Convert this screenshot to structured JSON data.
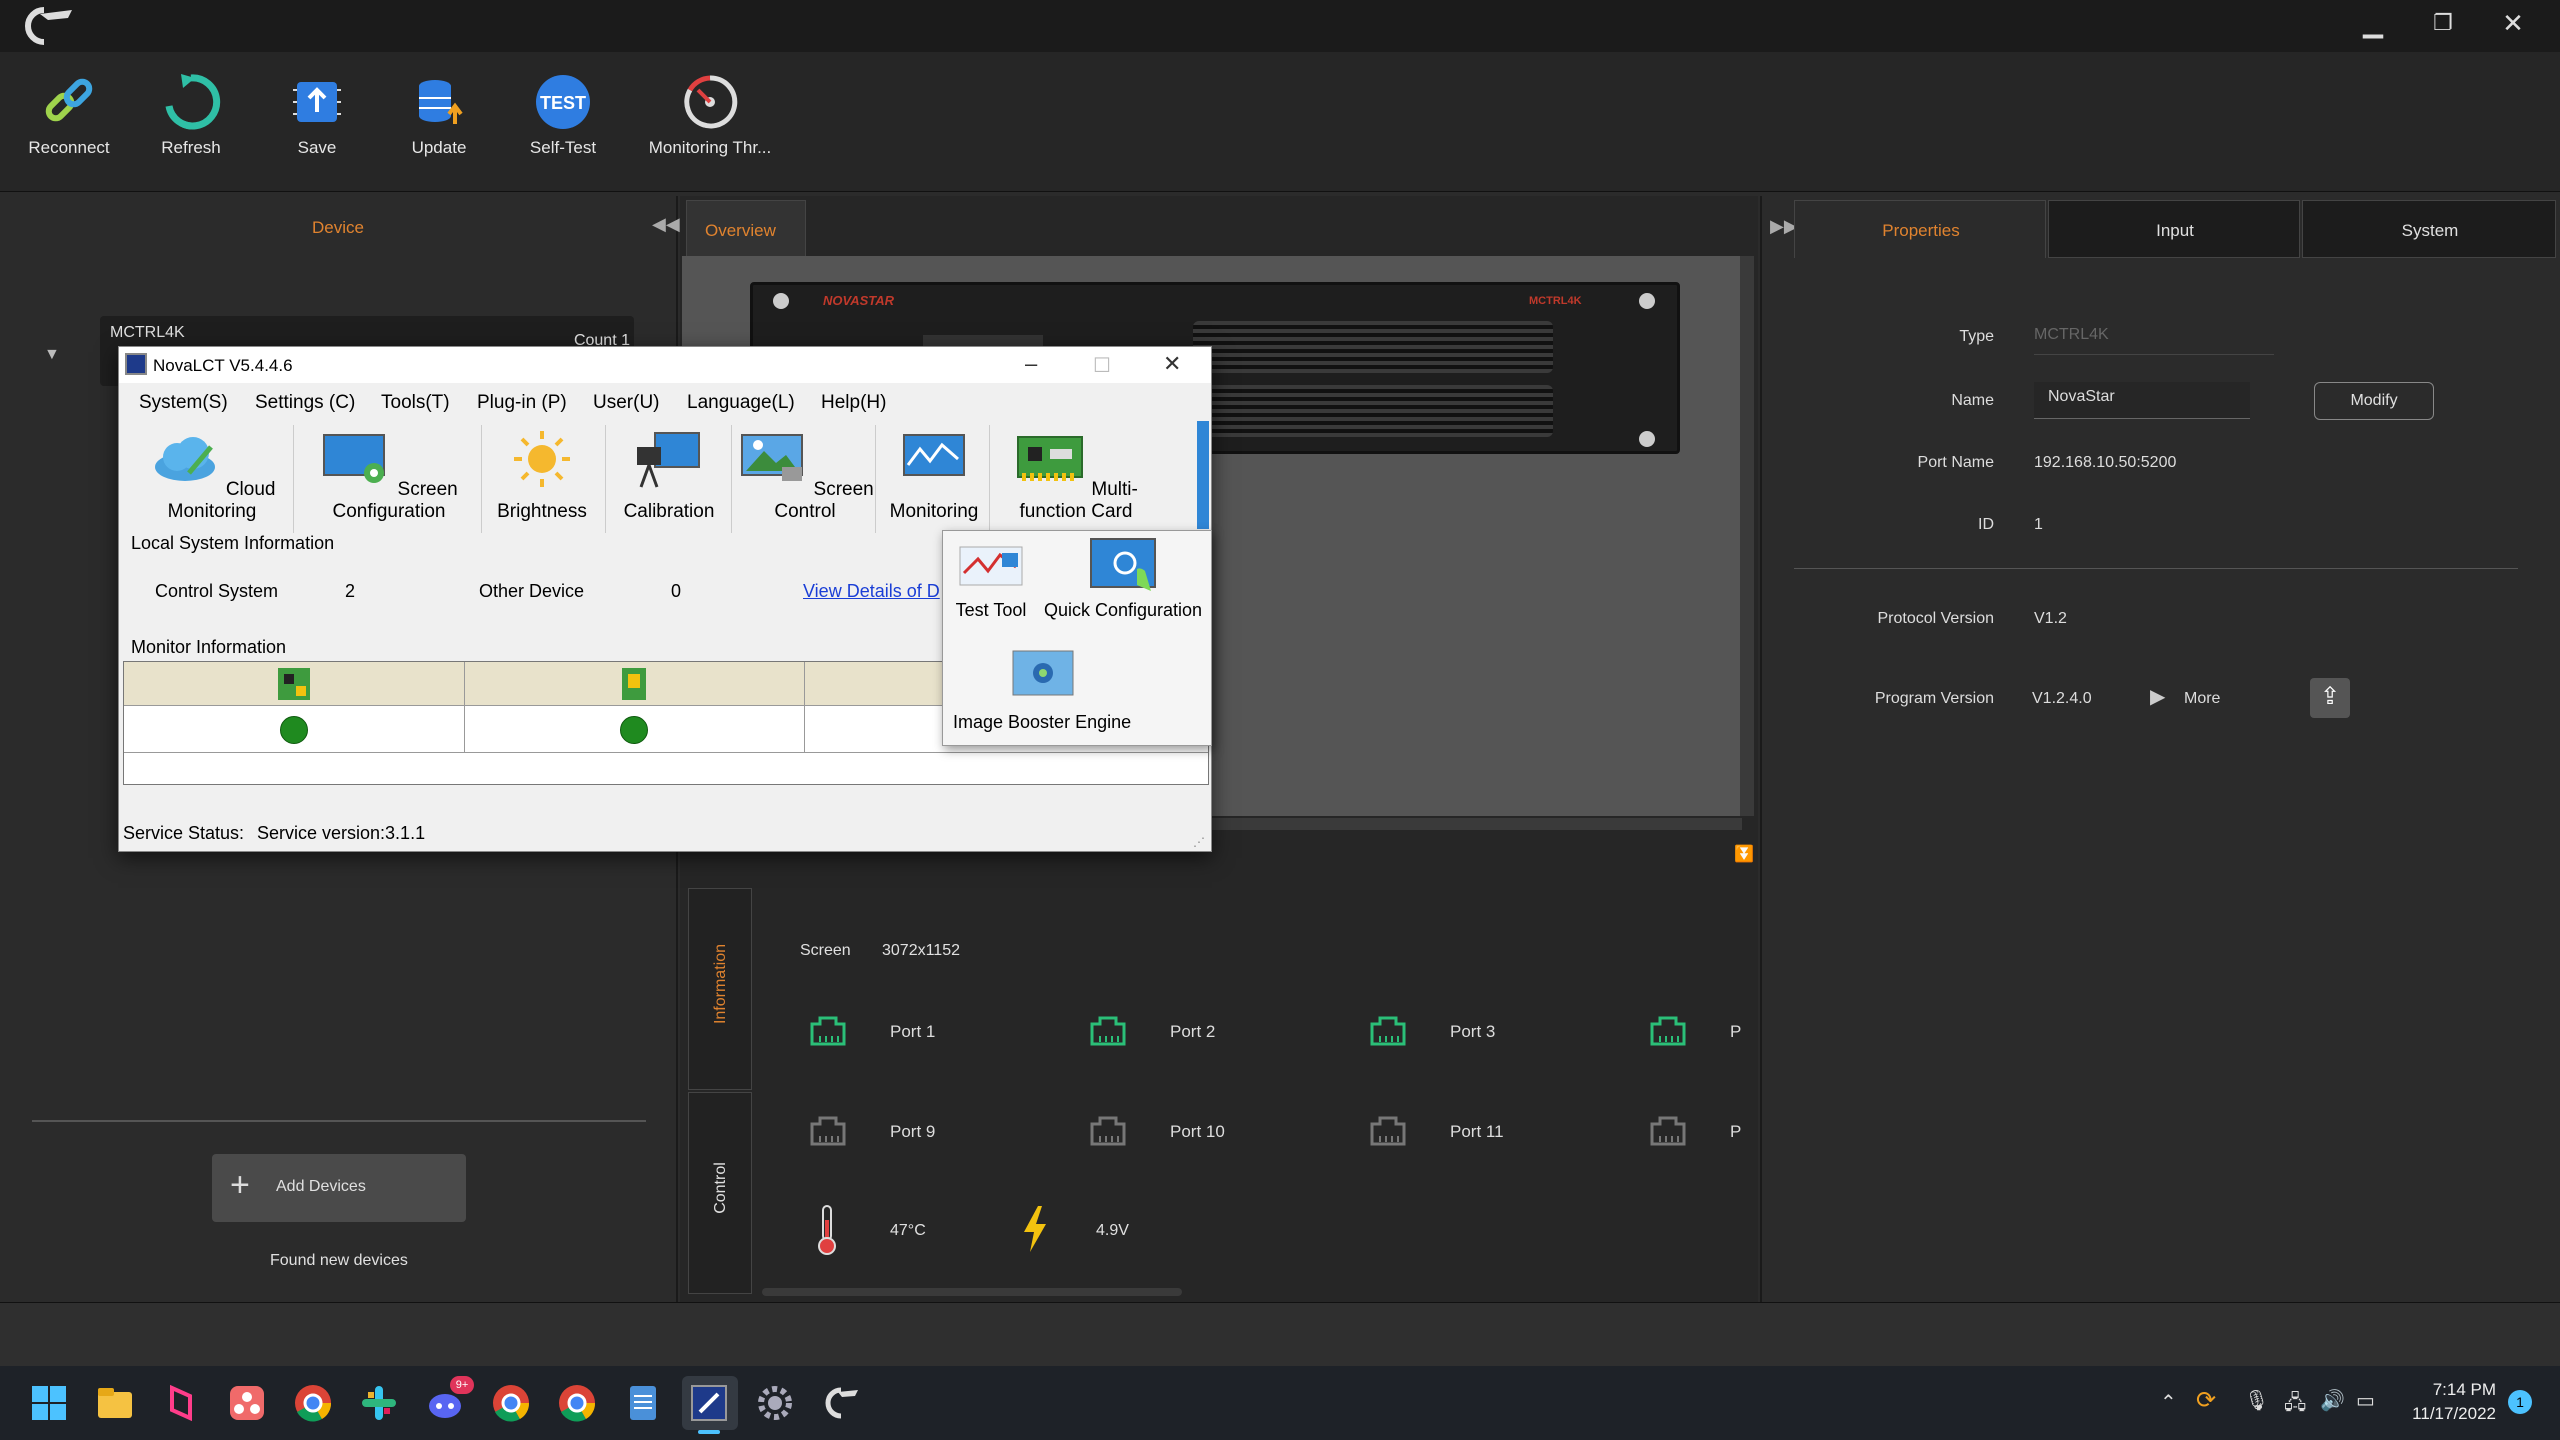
{
  "toolbar": {
    "reconnect": "Reconnect",
    "refresh": "Refresh",
    "save": "Save",
    "update": "Update",
    "self_test": "Self-Test",
    "self_test_badge": "TEST",
    "monitoring": "Monitoring Thr..."
  },
  "left": {
    "tab": "Device",
    "device_name": "MCTRL4K",
    "count": "Count 1",
    "add_devices": "Add Devices",
    "found": "Found new devices"
  },
  "center": {
    "tab": "Overview",
    "side_tab_info": "Information",
    "side_tab_control": "Control",
    "device_brand": "NOVASTAR",
    "device_model": "MCTRL4K",
    "screen_label": "Screen",
    "screen_value": "3072x1152",
    "ports": [
      "Port 1",
      "Port 2",
      "Port 3",
      "P",
      "Port 9",
      "Port 10",
      "Port 11",
      "P"
    ],
    "temperature": "47°C",
    "voltage": "4.9V"
  },
  "right": {
    "tabs": [
      "Properties",
      "Input",
      "System"
    ],
    "type_label": "Type",
    "type_value": "MCTRL4K",
    "name_label": "Name",
    "name_value": "NovaStar",
    "modify": "Modify",
    "port_name_label": "Port Name",
    "port_name_value": "192.168.10.50:5200",
    "id_label": "ID",
    "id_value": "1",
    "protocol_label": "Protocol Version",
    "protocol_value": "V1.2",
    "program_label": "Program Version",
    "program_value": "V1.2.4.0",
    "more": "More"
  },
  "dialog": {
    "title": "NovaLCT V5.4.4.6",
    "menus": [
      "System(S)",
      "Settings (C)",
      "Tools(T)",
      "Plug-in (P)",
      "User(U)",
      "Language(L)",
      "Help(H)"
    ],
    "tools": [
      "Cloud Monitoring",
      "Screen Configuration",
      "Brightness",
      "Calibration",
      "Screen Control",
      "Monitoring",
      "Multi-function Card"
    ],
    "local_info": "Local System Information",
    "control_system_label": "Control System",
    "control_system_value": "2",
    "other_device_label": "Other Device",
    "other_device_value": "0",
    "view_details": "View Details of D",
    "monitor_info": "Monitor Information",
    "service_status": "Service Status:",
    "service_version": "Service version:3.1.1",
    "popup_items": [
      "Test Tool",
      "Quick Configuration",
      "Image Booster Engine"
    ]
  },
  "taskbar": {
    "time": "7:14 PM",
    "date": "11/17/2022",
    "notification_count": "1",
    "discord_badge": "9+"
  }
}
